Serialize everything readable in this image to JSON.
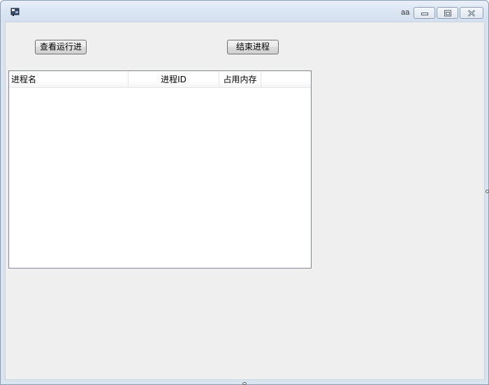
{
  "window": {
    "title": "aa",
    "icon": "app-window-icon",
    "caption_buttons": [
      "minimize-icon",
      "maximize-icon",
      "close-icon"
    ]
  },
  "toolbar": {
    "view_button_label": "查看运行进",
    "kill_button_label": "结束进程"
  },
  "process_list": {
    "columns": [
      "进程名",
      "进程ID",
      "占用内存"
    ],
    "rows": []
  }
}
